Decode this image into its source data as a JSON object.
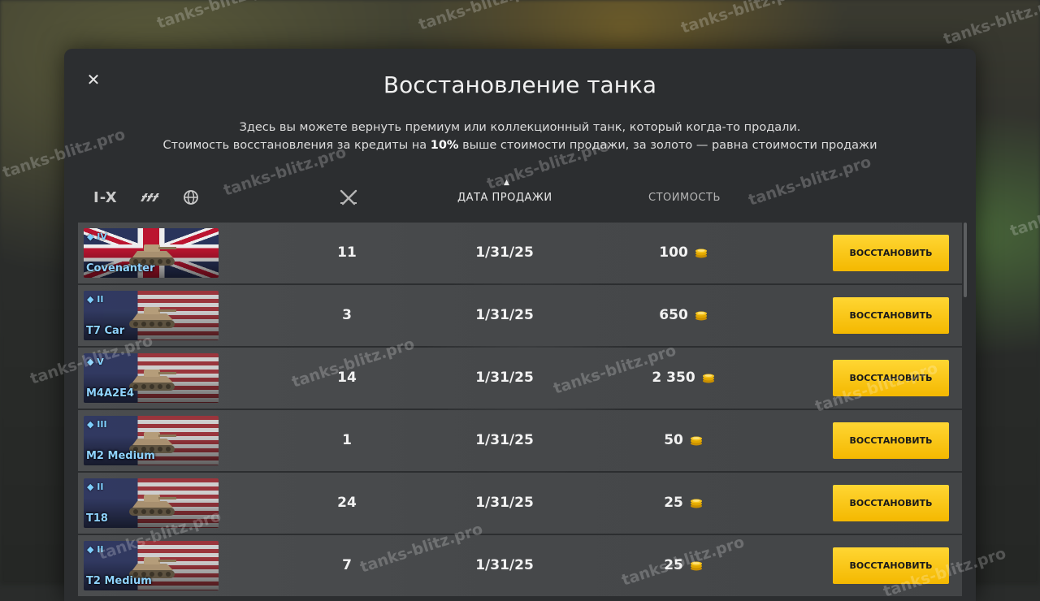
{
  "dialog": {
    "close_glyph": "✕",
    "title": "Восстановление танка",
    "subtitle_line1": "Здесь вы можете вернуть премиум или коллекционный танк, который когда-то продали.",
    "subtitle_line2_pre": "Стоимость восстановления за кредиты на ",
    "subtitle_line2_bold": "10%",
    "subtitle_line2_post": " выше стоимости продажи, за золото — равна стоимости продажи"
  },
  "filters": {
    "tier_label": "I-X",
    "type_icon": "tank-type-icon",
    "nation_icon": "globe-icon"
  },
  "columns": {
    "battles_icon": "crossed-swords-icon",
    "date": "ДАТА ПРОДАЖИ",
    "cost": "СТОИМОСТЬ",
    "sort_glyph": "▲"
  },
  "currency_icon": "gold-coin-icon",
  "restore_label": "ВОССТАНОВИТЬ",
  "rows": [
    {
      "tier": "IV",
      "name": "Covenanter",
      "nation": "uk",
      "battles": "11",
      "date": "1/31/25",
      "cost": "100"
    },
    {
      "tier": "II",
      "name": "T7 Car",
      "nation": "usa",
      "battles": "3",
      "date": "1/31/25",
      "cost": "650"
    },
    {
      "tier": "V",
      "name": "M4A2E4",
      "nation": "usa",
      "battles": "14",
      "date": "1/31/25",
      "cost": "2 350"
    },
    {
      "tier": "III",
      "name": "M2 Medium",
      "nation": "usa",
      "battles": "1",
      "date": "1/31/25",
      "cost": "50"
    },
    {
      "tier": "II",
      "name": "T18",
      "nation": "usa",
      "battles": "24",
      "date": "1/31/25",
      "cost": "25"
    },
    {
      "tier": "II",
      "name": "T2 Medium",
      "nation": "usa",
      "battles": "7",
      "date": "1/31/25",
      "cost": "25"
    }
  ],
  "watermark": "tanks-blitz.pro"
}
